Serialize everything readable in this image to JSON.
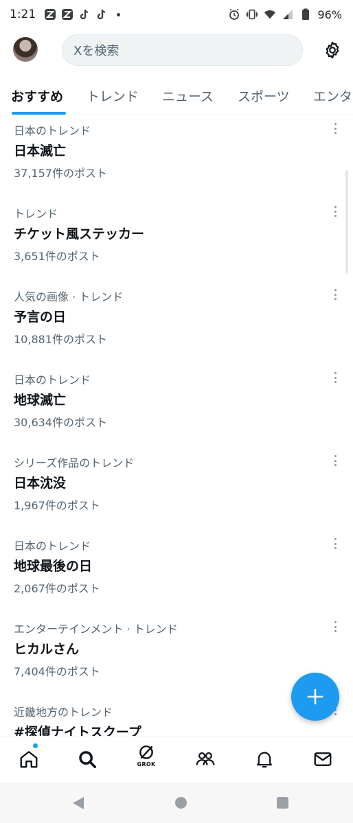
{
  "status_bar": {
    "time": "1:21",
    "battery": "96%",
    "left_icons": [
      "z-app-icon",
      "z-app-icon",
      "tiktok-icon",
      "tiktok-icon",
      "dot-icon"
    ],
    "right_icons": [
      "alarm-icon",
      "vibrate-icon",
      "wifi-icon",
      "signal-icon",
      "battery-icon"
    ]
  },
  "header": {
    "search_placeholder": "Xを検索"
  },
  "tabs": [
    {
      "label": "おすすめ",
      "active": true
    },
    {
      "label": "トレンド",
      "active": false
    },
    {
      "label": "ニュース",
      "active": false
    },
    {
      "label": "スポーツ",
      "active": false
    },
    {
      "label": "エンタ",
      "active": false
    }
  ],
  "trends": [
    {
      "category": "日本のトレンド",
      "title": "日本滅亡",
      "count": "37,157件のポスト"
    },
    {
      "category": "トレンド",
      "title": "チケット風ステッカー",
      "count": "3,651件のポスト"
    },
    {
      "category": "人気の画像 · トレンド",
      "title": "予言の日",
      "count": "10,881件のポスト"
    },
    {
      "category": "日本のトレンド",
      "title": "地球滅亡",
      "count": "30,634件のポスト"
    },
    {
      "category": "シリーズ作品のトレンド",
      "title": "日本沈没",
      "count": "1,967件のポスト"
    },
    {
      "category": "日本のトレンド",
      "title": "地球最後の日",
      "count": "2,067件のポスト"
    },
    {
      "category": "エンターテインメント · トレンド",
      "title": "ヒカルさん",
      "count": "7,404件のポスト"
    },
    {
      "category": "近畿地方のトレンド",
      "title": "#探偵ナイトスクープ",
      "count": ""
    }
  ],
  "bottom_nav": {
    "items": [
      "home-icon",
      "search-icon",
      "grok-icon",
      "communities-icon",
      "notifications-icon",
      "messages-icon"
    ],
    "grok_label": "GROK"
  },
  "colors": {
    "accent": "#1d9bf0",
    "text_primary": "#0f1419",
    "text_secondary": "#536471"
  }
}
